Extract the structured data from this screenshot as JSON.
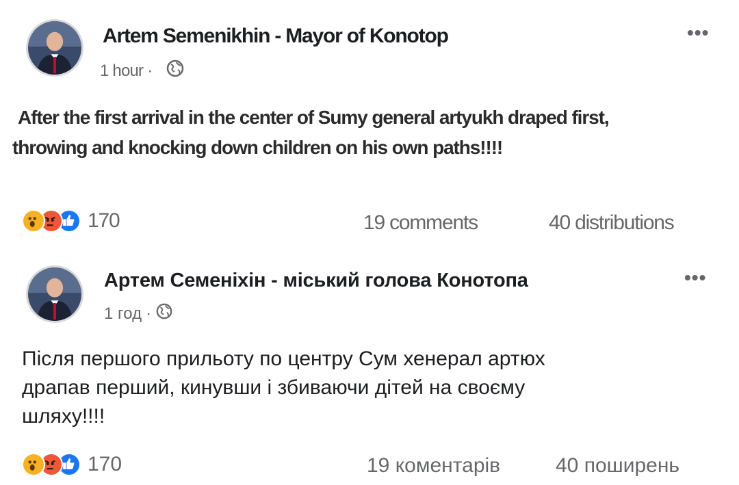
{
  "posts": [
    {
      "author": "Artem Semenikhin - Mayor of Konotop",
      "time": "1 hour",
      "separator": "·",
      "text_line1": "After the first arrival in the center of Sumy general artyukh draped first,",
      "text_line2": "throwing and knocking down children on his own paths!!!!",
      "reactions": [
        "wow-icon",
        "angry-icon",
        "like-icon"
      ],
      "reaction_count": "170",
      "comments": "19 comments",
      "shares": "40 distributions"
    },
    {
      "author": "Артем Семеніхін - міський голова Конотопа",
      "time": "1 год",
      "separator": "·",
      "text_line1": "Після першого прильоту по центру Сум хенерал артюх",
      "text_line2": "драпав перший, кинувши і збиваючи дітей на своєму",
      "text_line3": "шляху!!!!",
      "reactions": [
        "wow-icon",
        "angry-icon",
        "like-icon"
      ],
      "reaction_count": "170",
      "comments": "19 коментарів",
      "shares": "40 поширень"
    }
  ],
  "colors": {
    "like": "#1877f2",
    "angry": "#f0573a",
    "wow": "#f7b125",
    "secondary_text": "#65676b"
  }
}
